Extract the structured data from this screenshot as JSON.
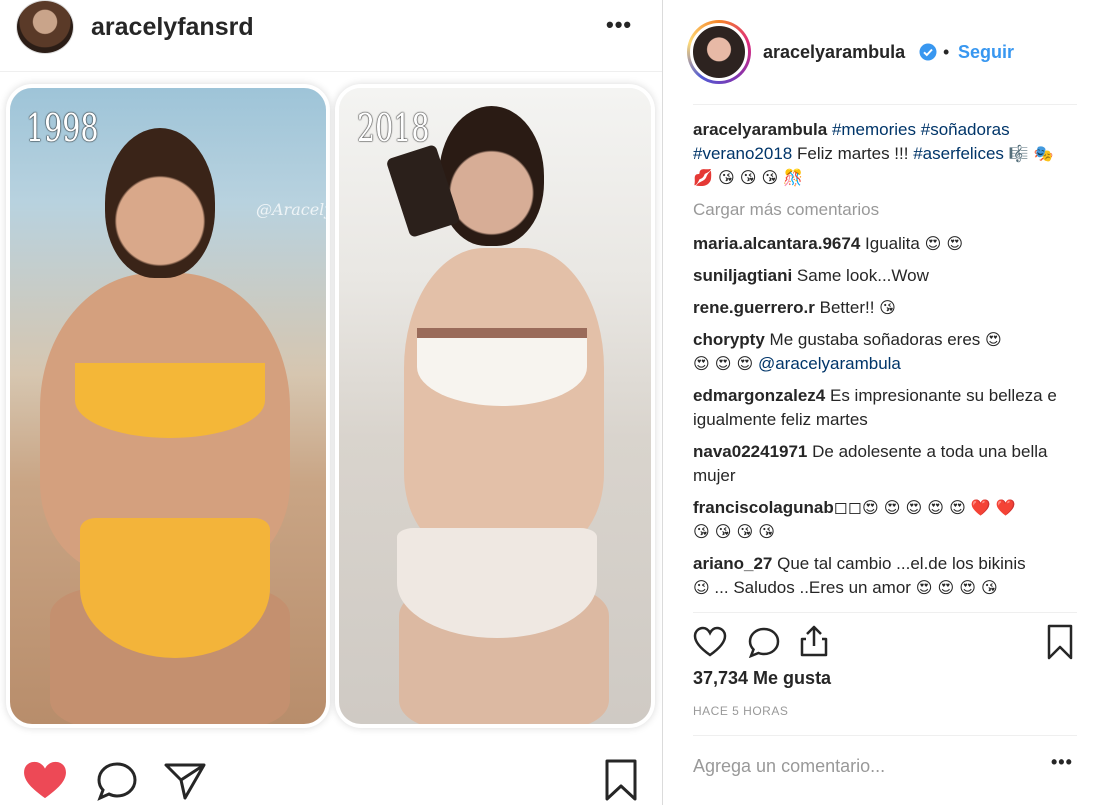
{
  "post_owner": {
    "username": "aracelyfansrd",
    "more_label": "•••"
  },
  "photos": {
    "left_year": "1998",
    "right_year": "2018",
    "watermark": "@AracelyFansRD"
  },
  "author": {
    "username": "aracelyarambula",
    "separator": "•",
    "follow_label": "Seguir"
  },
  "caption": {
    "username": "aracelyarambula",
    "tags_line1": "#memories #soñadoras",
    "tags_line2": "#verano2018",
    "text": "Feliz martes !!!",
    "tag_end": "#aserfelices",
    "emojis": "🎼 🎭 💋 😘 😘 😘 🎊"
  },
  "load_more_label": "Cargar más comentarios",
  "comments": [
    {
      "user": "maria.alcantara.9674",
      "text": "Igualita",
      "emojis": "😍 😍"
    },
    {
      "user": "suniljagtiani",
      "text": "Same look...Wow",
      "emojis": ""
    },
    {
      "user": "rene.guerrero.r",
      "text": "Better!!",
      "emojis": "😘"
    },
    {
      "user": "chorypty",
      "text": "Me gustaba soñadoras eres",
      "emojis": "😍",
      "line2_emojis": "😍 😍 😍",
      "mention": "@aracelyarambula"
    },
    {
      "user": "edmargonzalez4",
      "text": "Es impresionante su belleza e igualmente feliz martes",
      "emojis": ""
    },
    {
      "user": "nava02241971",
      "text": "De adolesente a toda una bella mujer",
      "emojis": ""
    },
    {
      "user": "franciscolagunab",
      "text": "◻◻",
      "emojis": "😍 😍 😍 😍 😍 ❤️ ❤️",
      "line2_emojis": "😘 😘 😘 😘"
    },
    {
      "user": "ariano_27",
      "text": "Que tal cambio ...el.de los bikinis",
      "emojis": "",
      "line2_prefix": "😉",
      "line2_text": "... Saludos ..Eres un amor",
      "line2_emojis": "😍 😍 😍 😘"
    }
  ],
  "likes_text": "37,734 Me gusta",
  "time_text": "HACE 5 HORAS",
  "add_comment_placeholder": "Agrega un comentario...",
  "more_label": "•••",
  "colors": {
    "link": "#3897f0",
    "heart_filled": "#ed4956",
    "muted": "#999999"
  }
}
